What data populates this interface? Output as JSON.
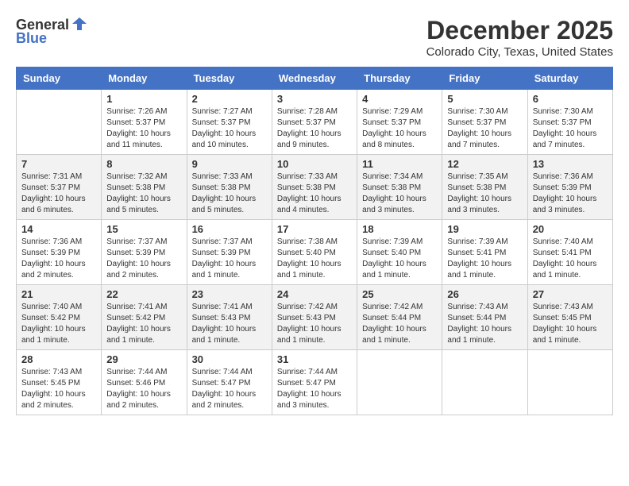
{
  "header": {
    "logo_general": "General",
    "logo_blue": "Blue",
    "month": "December 2025",
    "location": "Colorado City, Texas, United States"
  },
  "calendar": {
    "days_of_week": [
      "Sunday",
      "Monday",
      "Tuesday",
      "Wednesday",
      "Thursday",
      "Friday",
      "Saturday"
    ],
    "weeks": [
      [
        {
          "day": "",
          "info": ""
        },
        {
          "day": "1",
          "info": "Sunrise: 7:26 AM\nSunset: 5:37 PM\nDaylight: 10 hours\nand 11 minutes."
        },
        {
          "day": "2",
          "info": "Sunrise: 7:27 AM\nSunset: 5:37 PM\nDaylight: 10 hours\nand 10 minutes."
        },
        {
          "day": "3",
          "info": "Sunrise: 7:28 AM\nSunset: 5:37 PM\nDaylight: 10 hours\nand 9 minutes."
        },
        {
          "day": "4",
          "info": "Sunrise: 7:29 AM\nSunset: 5:37 PM\nDaylight: 10 hours\nand 8 minutes."
        },
        {
          "day": "5",
          "info": "Sunrise: 7:30 AM\nSunset: 5:37 PM\nDaylight: 10 hours\nand 7 minutes."
        },
        {
          "day": "6",
          "info": "Sunrise: 7:30 AM\nSunset: 5:37 PM\nDaylight: 10 hours\nand 7 minutes."
        }
      ],
      [
        {
          "day": "7",
          "info": "Sunrise: 7:31 AM\nSunset: 5:37 PM\nDaylight: 10 hours\nand 6 minutes."
        },
        {
          "day": "8",
          "info": "Sunrise: 7:32 AM\nSunset: 5:38 PM\nDaylight: 10 hours\nand 5 minutes."
        },
        {
          "day": "9",
          "info": "Sunrise: 7:33 AM\nSunset: 5:38 PM\nDaylight: 10 hours\nand 5 minutes."
        },
        {
          "day": "10",
          "info": "Sunrise: 7:33 AM\nSunset: 5:38 PM\nDaylight: 10 hours\nand 4 minutes."
        },
        {
          "day": "11",
          "info": "Sunrise: 7:34 AM\nSunset: 5:38 PM\nDaylight: 10 hours\nand 3 minutes."
        },
        {
          "day": "12",
          "info": "Sunrise: 7:35 AM\nSunset: 5:38 PM\nDaylight: 10 hours\nand 3 minutes."
        },
        {
          "day": "13",
          "info": "Sunrise: 7:36 AM\nSunset: 5:39 PM\nDaylight: 10 hours\nand 3 minutes."
        }
      ],
      [
        {
          "day": "14",
          "info": "Sunrise: 7:36 AM\nSunset: 5:39 PM\nDaylight: 10 hours\nand 2 minutes."
        },
        {
          "day": "15",
          "info": "Sunrise: 7:37 AM\nSunset: 5:39 PM\nDaylight: 10 hours\nand 2 minutes."
        },
        {
          "day": "16",
          "info": "Sunrise: 7:37 AM\nSunset: 5:39 PM\nDaylight: 10 hours\nand 1 minute."
        },
        {
          "day": "17",
          "info": "Sunrise: 7:38 AM\nSunset: 5:40 PM\nDaylight: 10 hours\nand 1 minute."
        },
        {
          "day": "18",
          "info": "Sunrise: 7:39 AM\nSunset: 5:40 PM\nDaylight: 10 hours\nand 1 minute."
        },
        {
          "day": "19",
          "info": "Sunrise: 7:39 AM\nSunset: 5:41 PM\nDaylight: 10 hours\nand 1 minute."
        },
        {
          "day": "20",
          "info": "Sunrise: 7:40 AM\nSunset: 5:41 PM\nDaylight: 10 hours\nand 1 minute."
        }
      ],
      [
        {
          "day": "21",
          "info": "Sunrise: 7:40 AM\nSunset: 5:42 PM\nDaylight: 10 hours\nand 1 minute."
        },
        {
          "day": "22",
          "info": "Sunrise: 7:41 AM\nSunset: 5:42 PM\nDaylight: 10 hours\nand 1 minute."
        },
        {
          "day": "23",
          "info": "Sunrise: 7:41 AM\nSunset: 5:43 PM\nDaylight: 10 hours\nand 1 minute."
        },
        {
          "day": "24",
          "info": "Sunrise: 7:42 AM\nSunset: 5:43 PM\nDaylight: 10 hours\nand 1 minute."
        },
        {
          "day": "25",
          "info": "Sunrise: 7:42 AM\nSunset: 5:44 PM\nDaylight: 10 hours\nand 1 minute."
        },
        {
          "day": "26",
          "info": "Sunrise: 7:43 AM\nSunset: 5:44 PM\nDaylight: 10 hours\nand 1 minute."
        },
        {
          "day": "27",
          "info": "Sunrise: 7:43 AM\nSunset: 5:45 PM\nDaylight: 10 hours\nand 1 minute."
        }
      ],
      [
        {
          "day": "28",
          "info": "Sunrise: 7:43 AM\nSunset: 5:45 PM\nDaylight: 10 hours\nand 2 minutes."
        },
        {
          "day": "29",
          "info": "Sunrise: 7:44 AM\nSunset: 5:46 PM\nDaylight: 10 hours\nand 2 minutes."
        },
        {
          "day": "30",
          "info": "Sunrise: 7:44 AM\nSunset: 5:47 PM\nDaylight: 10 hours\nand 2 minutes."
        },
        {
          "day": "31",
          "info": "Sunrise: 7:44 AM\nSunset: 5:47 PM\nDaylight: 10 hours\nand 3 minutes."
        },
        {
          "day": "",
          "info": ""
        },
        {
          "day": "",
          "info": ""
        },
        {
          "day": "",
          "info": ""
        }
      ]
    ]
  }
}
